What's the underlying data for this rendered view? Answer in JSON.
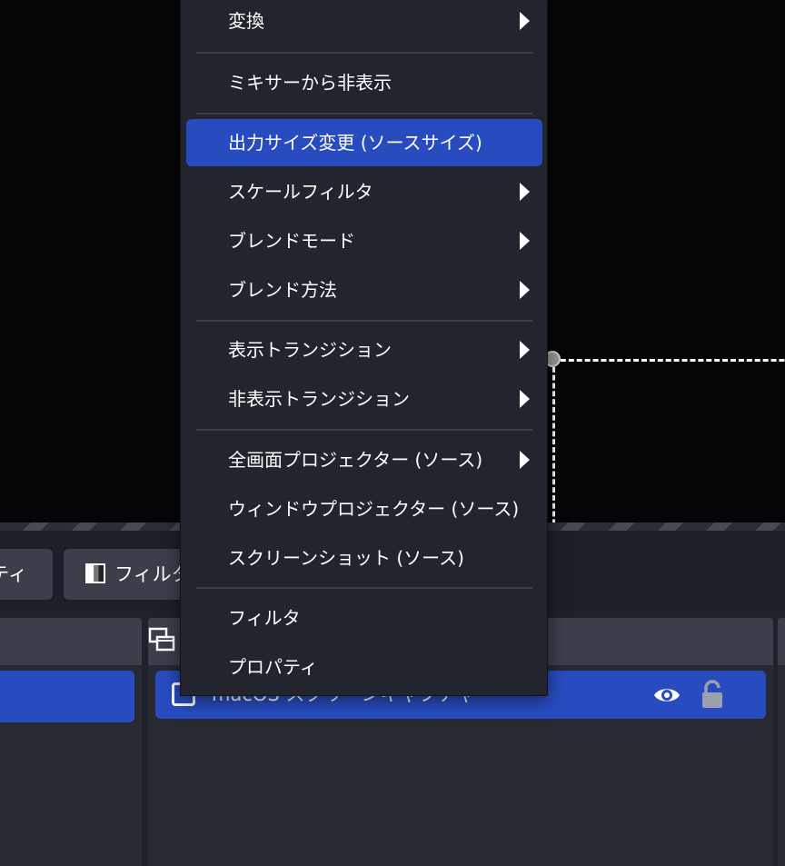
{
  "toolbar": {
    "properties_label": "ティ",
    "filters_label": "フィルタ"
  },
  "sources": {
    "rows": [
      {
        "label": "macOS スクリーンキャプチャ",
        "visible_icon": "eye-icon",
        "lock_icon": "lock-icon"
      }
    ]
  },
  "context_menu": {
    "items": [
      {
        "label": "変換",
        "submenu": true
      },
      {
        "label": "ミキサーから非表示",
        "submenu": false
      },
      {
        "label": "出力サイズ変更 (ソースサイズ)",
        "submenu": false,
        "highlighted": true
      },
      {
        "label": "スケールフィルタ",
        "submenu": true
      },
      {
        "label": "ブレンドモード",
        "submenu": true
      },
      {
        "label": "ブレンド方法",
        "submenu": true
      },
      {
        "label": "表示トランジション",
        "submenu": true
      },
      {
        "label": "非表示トランジション",
        "submenu": true
      },
      {
        "label": "全画面プロジェクター (ソース)",
        "submenu": true
      },
      {
        "label": "ウィンドウプロジェクター (ソース)",
        "submenu": false
      },
      {
        "label": "スクリーンショット (ソース)",
        "submenu": false
      },
      {
        "label": "フィルタ",
        "submenu": false
      },
      {
        "label": "プロパティ",
        "submenu": false
      }
    ]
  },
  "colors": {
    "highlight": "#284cbf",
    "menu_bg": "#22252d",
    "preview_bg": "#050508"
  }
}
